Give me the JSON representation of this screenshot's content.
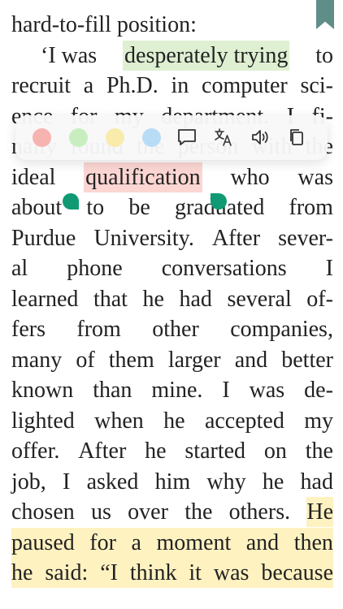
{
  "book": {
    "lines": [
      {
        "parts": [
          "hard-to-fill position:"
        ]
      },
      {
        "parts": [
          "‘I was",
          "desperately trying",
          "to"
        ]
      },
      {
        "parts": [
          "recruit",
          "a",
          "Ph.D.",
          "in",
          "computer",
          "sci-"
        ]
      },
      {
        "parts": [
          "ence",
          "for",
          "my",
          "department.",
          "I",
          "fi-"
        ]
      },
      {
        "parts": [
          "nally",
          "found",
          "the",
          "person",
          "with",
          "the"
        ]
      },
      {
        "parts": [
          "ideal",
          "qualification",
          "who",
          "was"
        ]
      },
      {
        "parts": [
          "about",
          "to",
          "be",
          "graduated",
          "from"
        ]
      },
      {
        "parts": [
          "Purdue",
          "University.",
          "After",
          "sever-"
        ]
      },
      {
        "parts": [
          "al",
          "phone",
          "conversations",
          "I"
        ]
      },
      {
        "parts": [
          "learned",
          "that",
          "he",
          "had",
          "several",
          "of-"
        ]
      },
      {
        "parts": [
          "fers",
          "from",
          "other",
          "companies,"
        ]
      },
      {
        "parts": [
          "many",
          "of",
          "them",
          "larger",
          "and",
          "better"
        ]
      },
      {
        "parts": [
          "known",
          "than",
          "mine.",
          "I",
          "was",
          "de-"
        ]
      },
      {
        "parts": [
          "lighted",
          "when",
          "he",
          "accepted",
          "my"
        ]
      },
      {
        "parts": [
          "offer.",
          "After",
          "he",
          "started",
          "on",
          "the"
        ]
      },
      {
        "parts": [
          "job,",
          "I",
          "asked",
          "him",
          "why",
          "he",
          "had"
        ]
      },
      {
        "parts": [
          "chosen",
          "us",
          "over",
          "the",
          "others.",
          "He"
        ]
      },
      {
        "parts": [
          "paused",
          "for",
          "a",
          "moment",
          "and",
          "then"
        ]
      },
      {
        "parts": [
          "he",
          "said:",
          "“I",
          "think",
          "it",
          "was",
          "because"
        ]
      }
    ]
  },
  "toolbar": {
    "colors": [
      "#f7b3b0",
      "#c8eec0",
      "#f9ebac",
      "#b9dcf6"
    ],
    "tools": [
      "note-icon",
      "translate-icon",
      "read-aloud-icon",
      "copy-icon"
    ]
  }
}
